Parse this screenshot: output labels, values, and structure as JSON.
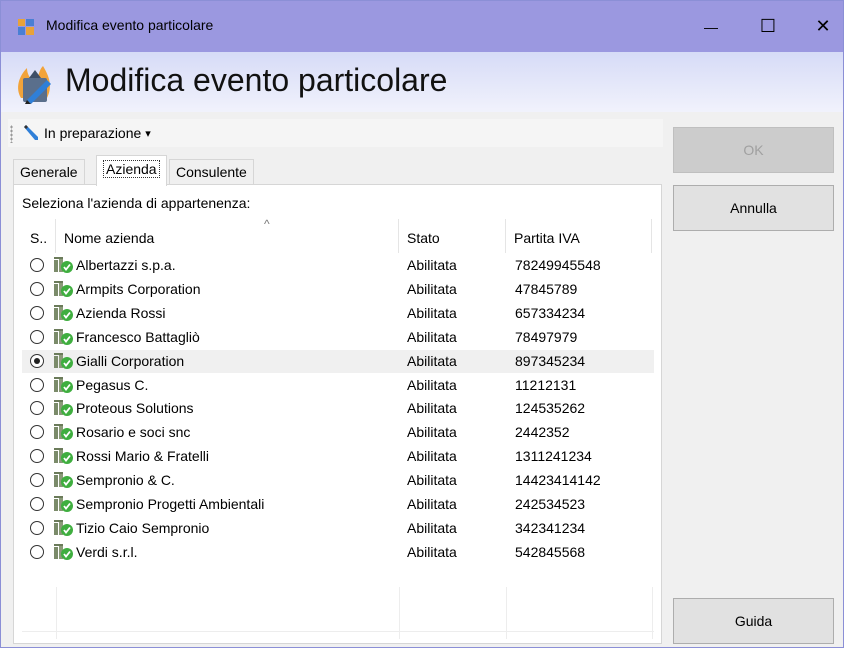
{
  "window": {
    "title": "Modifica evento particolare",
    "controls": {
      "minimize": "—",
      "maximize": "☐",
      "close": "✕"
    }
  },
  "header": {
    "title": "Modifica evento particolare"
  },
  "toolbar": {
    "status_label": "In preparazione",
    "status_arrow": "▾"
  },
  "tabs": [
    {
      "label": "Generale"
    },
    {
      "label": "Azienda"
    },
    {
      "label": "Consulente"
    }
  ],
  "panel": {
    "caption": "Seleziona l'azienda di appartenenza:"
  },
  "grid": {
    "columns": [
      "S..",
      "Nome azienda",
      "Stato",
      "Partita IVA"
    ],
    "sort_indicator": "^",
    "rows": [
      {
        "selected": false,
        "name": "Albertazzi s.p.a.",
        "stato": "Abilitata",
        "piva": "78249945548"
      },
      {
        "selected": false,
        "name": "Armpits Corporation",
        "stato": "Abilitata",
        "piva": "47845789"
      },
      {
        "selected": false,
        "name": "Azienda Rossi",
        "stato": "Abilitata",
        "piva": "657334234"
      },
      {
        "selected": false,
        "name": "Francesco Battagliò",
        "stato": "Abilitata",
        "piva": "78497979"
      },
      {
        "selected": true,
        "name": "Gialli Corporation",
        "stato": "Abilitata",
        "piva": "897345234"
      },
      {
        "selected": false,
        "name": "Pegasus C.",
        "stato": "Abilitata",
        "piva": "11212131"
      },
      {
        "selected": false,
        "name": "Proteous Solutions",
        "stato": "Abilitata",
        "piva": "124535262"
      },
      {
        "selected": false,
        "name": "Rosario e soci snc",
        "stato": "Abilitata",
        "piva": "2442352"
      },
      {
        "selected": false,
        "name": "Rossi Mario & Fratelli",
        "stato": "Abilitata",
        "piva": "1311241234"
      },
      {
        "selected": false,
        "name": "Sempronio & C.",
        "stato": "Abilitata",
        "piva": "14423414142"
      },
      {
        "selected": false,
        "name": "Sempronio Progetti Ambientali",
        "stato": "Abilitata",
        "piva": "242534523"
      },
      {
        "selected": false,
        "name": "Tizio Caio Sempronio",
        "stato": "Abilitata",
        "piva": "342341234"
      },
      {
        "selected": false,
        "name": "Verdi s.r.l.",
        "stato": "Abilitata",
        "piva": "542845568"
      }
    ]
  },
  "buttons": {
    "ok": "OK",
    "annulla": "Annulla",
    "guida": "Guida"
  },
  "colors": {
    "titlebar": "#9b98e0",
    "header_gradient_top": "#d6dbf7",
    "selected_row": "#f0f0f0"
  }
}
